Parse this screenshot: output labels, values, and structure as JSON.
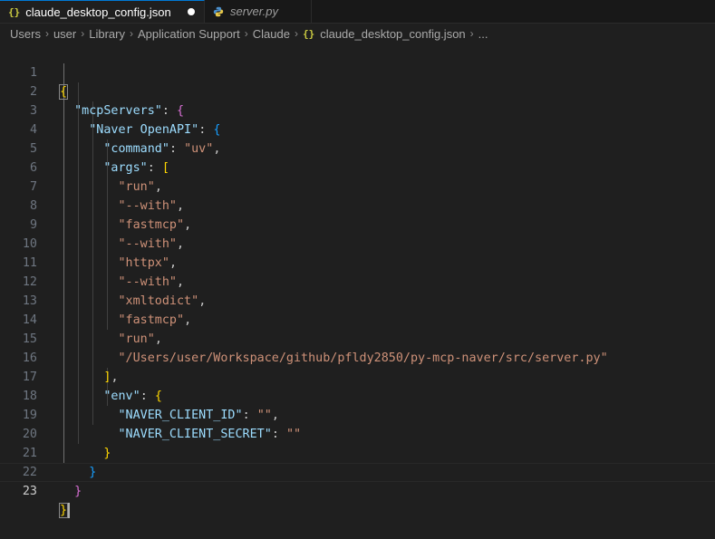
{
  "tabs": [
    {
      "icon": "{}",
      "label": "claude_desktop_config.json",
      "modified": true,
      "active": true
    },
    {
      "icon": "python-icon",
      "label": "server.py",
      "modified": false,
      "active": false
    }
  ],
  "breadcrumb": {
    "parts": [
      "Users",
      "user",
      "Library",
      "Application Support",
      "Claude"
    ],
    "file_icon": "{}",
    "file": "claude_desktop_config.json",
    "more": "..."
  },
  "editor": {
    "line_numbers": [
      "1",
      "2",
      "3",
      "4",
      "5",
      "6",
      "7",
      "8",
      "9",
      "10",
      "11",
      "12",
      "13",
      "14",
      "15",
      "16",
      "17",
      "18",
      "19",
      "20",
      "21",
      "22",
      "23"
    ],
    "json": {
      "mcpServers_key": "\"mcpServers\"",
      "server_key": "\"Naver OpenAPI\"",
      "command_key": "\"command\"",
      "command_val": "\"uv\"",
      "args_key": "\"args\"",
      "args": [
        "\"run\"",
        "\"--with\"",
        "\"fastmcp\"",
        "\"--with\"",
        "\"httpx\"",
        "\"--with\"",
        "\"xmltodict\"",
        "\"fastmcp\"",
        "\"run\"",
        "\"/Users/user/Workspace/github/pfldy2850/py-mcp-naver/src/server.py\""
      ],
      "env_key": "\"env\"",
      "client_id_key": "\"NAVER_CLIENT_ID\"",
      "client_id_val": "\"\"",
      "client_secret_key": "\"NAVER_CLIENT_SECRET\"",
      "client_secret_val": "\"\""
    }
  },
  "colors": {
    "key": "#9cdcfe",
    "string": "#ce9178",
    "bracket_level1": "#ffd700",
    "bracket_level2": "#da70d6",
    "bracket_level3": "#179fff",
    "json_icon": "#cbcb41"
  }
}
